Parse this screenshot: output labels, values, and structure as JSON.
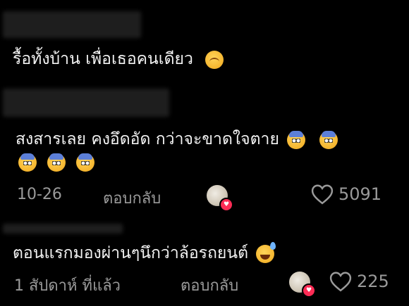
{
  "colors": {
    "background": "#000000",
    "text": "#f2f2f2",
    "meta": "#9a9a9a",
    "badge": "#fe2c55"
  },
  "comments": [
    {
      "text": "รื้อทั้งบ้าน เพื่อเธอคนเดียว",
      "emojis": [
        "relieved-face-emoji"
      ]
    },
    {
      "text_line1": "สงสารเลย คงอึดอัด กว่าจะขาดใจตาย",
      "emojis_line1": [
        "cold-face-emoji",
        "cold-face-emoji"
      ],
      "emojis_line2": [
        "cold-face-emoji",
        "cold-face-emoji",
        "cold-face-emoji"
      ],
      "date": "10-26",
      "reply_label": "ตอบกลับ",
      "likes": "5091"
    },
    {
      "text": "ตอนแรกมองผ่านๆนึกว่าล้อรถยนต์",
      "emojis": [
        "grinning-sweat-emoji"
      ],
      "date": "1 สัปดาห์ ที่แล้ว",
      "reply_label": "ตอบกลับ",
      "likes": "225"
    }
  ]
}
